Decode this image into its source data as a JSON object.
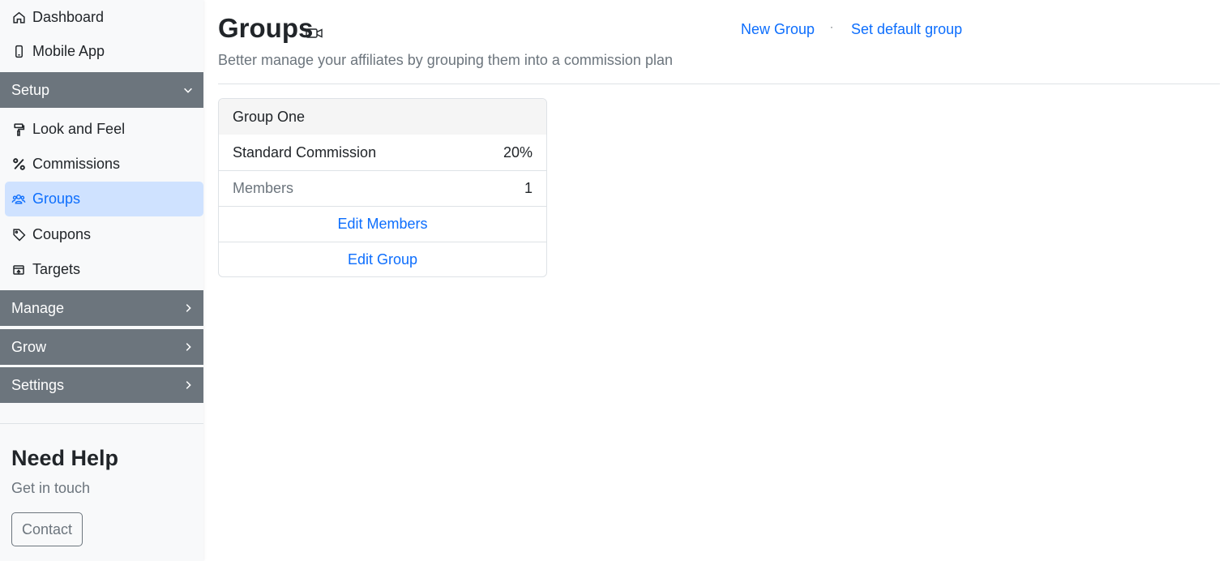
{
  "sidebar": {
    "top_items": [
      {
        "label": "Dashboard",
        "icon": "home-icon"
      },
      {
        "label": "Mobile App",
        "icon": "mobile-icon"
      }
    ],
    "setup": {
      "label": "Setup",
      "items": [
        {
          "label": "Look and Feel",
          "icon": "paint-roller-icon"
        },
        {
          "label": "Commissions",
          "icon": "percent-icon"
        },
        {
          "label": "Groups",
          "icon": "people-icon",
          "active": true
        },
        {
          "label": "Coupons",
          "icon": "tag-icon"
        },
        {
          "label": "Targets",
          "icon": "target-icon"
        }
      ]
    },
    "sections": [
      "Manage",
      "Grow",
      "Settings"
    ],
    "help": {
      "title": "Need Help",
      "subtitle": "Get in touch",
      "contact_label": "Contact"
    }
  },
  "main": {
    "title": "Groups",
    "subtitle": "Better manage your affiliates by grouping them into a commission plan",
    "new_group_label": "New Group",
    "separator": "·",
    "set_default_label": "Set default group",
    "group_card": {
      "name": "Group One",
      "commission_label": "Standard Commission",
      "commission_value": "20%",
      "members_label": "Members",
      "members_value": "1",
      "edit_members_label": "Edit Members",
      "edit_group_label": "Edit Group"
    }
  },
  "colors": {
    "accent": "#0d6efd",
    "section_bg": "#6c757d",
    "active_bg": "#cfe2ff",
    "sidebar_bg": "#f8f9fa"
  }
}
